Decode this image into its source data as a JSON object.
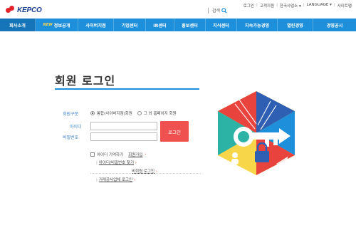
{
  "header": {
    "logo_text": "KEPCO",
    "search_label": "검색",
    "util_links": [
      "로그인",
      "고객지원",
      "한국사업소",
      "LANGUAGE",
      "사이트맵"
    ]
  },
  "nav": {
    "items": [
      "회사소개",
      "정보공개",
      "사이버지점",
      "기업센터",
      "IR센터",
      "홍보센터",
      "지식센터",
      "지속가능경영",
      "열린경영",
      "경영공시"
    ],
    "badge": "NEW"
  },
  "page": {
    "title": "회원 로그인"
  },
  "form": {
    "member_type_label": "회원구분",
    "member_type_options": [
      "통합(사이버지점)회원",
      "그 외 홈페이지 회원"
    ],
    "selected_option": "통합(사이버지점)회원",
    "id_label": "아이디",
    "password_label": "비밀번호",
    "id_value": "",
    "password_value": "",
    "login_button": "로그인",
    "remember_id": "아이디 기억하기",
    "join_link": "회원가입",
    "find_link": "아이디/비밀번호 찾기",
    "nonmember_link": "비회원 로그인",
    "corporate_link": "거래공사업체 로그인"
  },
  "colors": {
    "nav_bg": "#1d8fdb",
    "login_button_bg": "#ef5050",
    "label_color": "#3a7fc4"
  }
}
